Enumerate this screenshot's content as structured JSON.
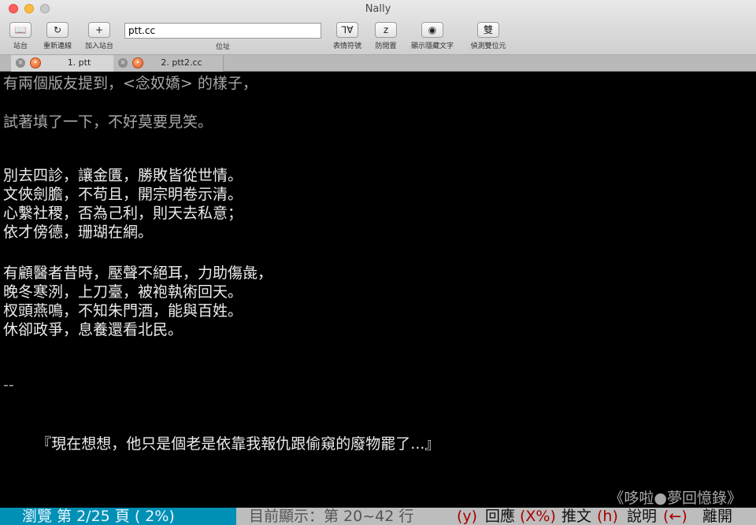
{
  "window": {
    "title": "Nally"
  },
  "toolbar": {
    "buttons": [
      {
        "icon": "book-icon",
        "glyph": "📖",
        "label": "站台"
      },
      {
        "icon": "reload-icon",
        "glyph": "↻",
        "label": "重新連線"
      },
      {
        "icon": "add-icon",
        "glyph": "+",
        "label": "加入站台"
      },
      {
        "icon": "emoticon-icon",
        "glyph": "⅂Ɐ",
        "label": "表情符號"
      },
      {
        "icon": "anti-idle-icon",
        "glyph": "z",
        "label": "防閒置"
      },
      {
        "icon": "eye-icon",
        "glyph": "◉",
        "label": "顯示隱藏文字"
      },
      {
        "icon": "double-byte-icon",
        "glyph": "雙",
        "label": "偵測雙位元"
      }
    ],
    "address": {
      "value": "ptt.cc",
      "label": "位址"
    }
  },
  "tabs": [
    {
      "label": "1. ptt",
      "active": true
    },
    {
      "label": "2. ptt2.cc",
      "active": false
    }
  ],
  "terminal": {
    "lines": [
      {
        "text": "有兩個版友提到，<念奴嬌> 的樣子，",
        "style": "dim"
      },
      {
        "text": "",
        "style": "dim"
      },
      {
        "text": "試著填了一下，不好莫要見笑。",
        "style": "dim"
      },
      {
        "text": "",
        "style": "dim"
      },
      {
        "text": "",
        "style": "dim"
      },
      {
        "text": "別去四診，讓金匱，勝敗皆從世情。",
        "style": "bright"
      },
      {
        "text": "文俠劍膽，不苟且，開宗明卷示清。",
        "style": "bright"
      },
      {
        "text": "心繫社稷，否為己利，則天去私意；",
        "style": "bright"
      },
      {
        "text": "依才傍德，珊瑚在網。",
        "style": "bright"
      },
      {
        "text": "",
        "style": "bright"
      },
      {
        "text": "有顧醫者昔時，壓聲不絕耳，力助傷彘，",
        "style": "bright"
      },
      {
        "text": "晚冬寒洌，上刀臺，被袍執術回天。",
        "style": "bright"
      },
      {
        "text": "杈頭燕鳴，不知朱門酒，能與百姓。",
        "style": "bright"
      },
      {
        "text": "休卻政爭，息養還看北民。",
        "style": "bright"
      },
      {
        "text": "",
        "style": "bright"
      },
      {
        "text": "",
        "style": "bright"
      },
      {
        "text": "--",
        "style": "dim"
      },
      {
        "text": "",
        "style": "dim"
      },
      {
        "text": "",
        "style": "dim"
      },
      {
        "text": "       『現在想想，他只是個老是依靠我報仇跟偷窺的廢物罷了...』",
        "style": "bright"
      }
    ],
    "signature": "《哆啦●夢回憶錄》"
  },
  "status_bar": {
    "browse": "瀏覽 第 2/25 頁 (  2%)",
    "range": "目前顯示：第 20~42 行",
    "actions": [
      {
        "key": "(y)",
        "label": "回應"
      },
      {
        "key": "(X%)",
        "label": "推文"
      },
      {
        "key": "(h)",
        "label": "說明"
      },
      {
        "key": "(←)",
        "label": "離開"
      }
    ]
  }
}
